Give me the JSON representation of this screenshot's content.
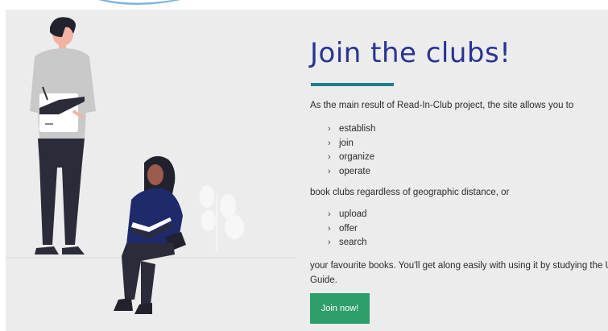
{
  "hero": {
    "title": "Join the clubs!",
    "intro": "As the main result of Read-In-Club project, the site allows you to",
    "club_actions": [
      "establish",
      "join",
      "organize",
      "operate"
    ],
    "middle": "book clubs regardless of geographic distance, or",
    "book_actions": [
      "upload",
      "offer",
      "search"
    ],
    "outro_line1": "your favourite books. You'll get along easily with using it by studying the Use",
    "outro_line2": "Guide.",
    "cta_label": "Join now!",
    "bullet_icon": "chevron-right-icon"
  },
  "colors": {
    "title": "#283593",
    "accent_underline": "#1e7d8d",
    "button": "#2e9e6a",
    "panel_bg": "#ececec"
  }
}
